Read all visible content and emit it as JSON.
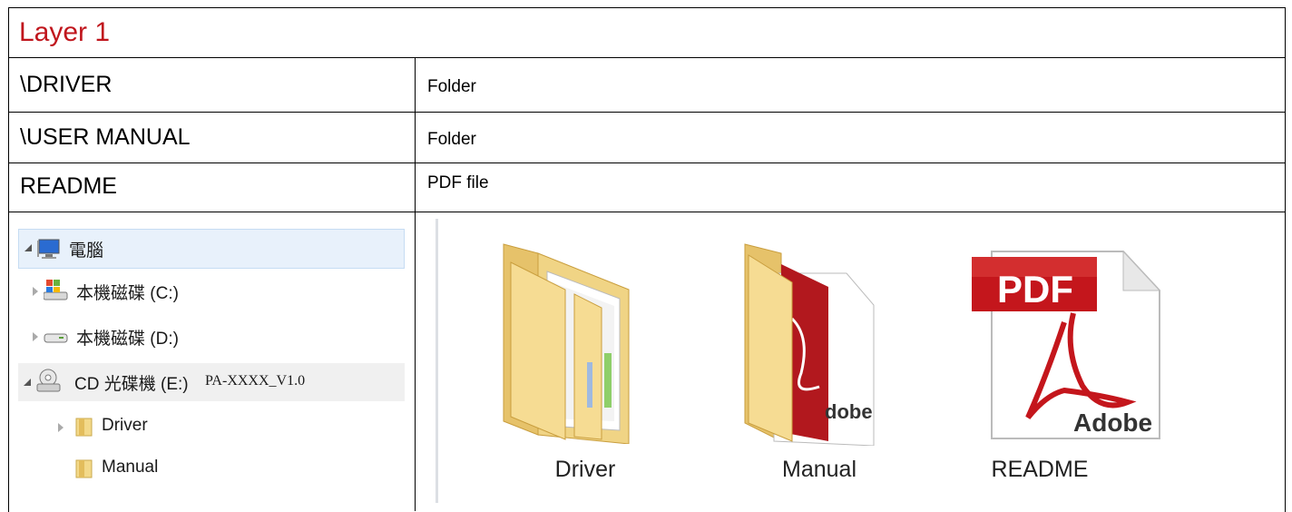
{
  "header": {
    "title": "Layer 1"
  },
  "rows": [
    {
      "name": "\\DRIVER",
      "type": "Folder"
    },
    {
      "name": "\\USER MANUAL",
      "type": "Folder"
    },
    {
      "name": "README",
      "type": "PDF file"
    }
  ],
  "tree": {
    "computer": "電腦",
    "drive_c": "本機磁碟 (C:)",
    "drive_d": "本機磁碟 (D:)",
    "drive_e": "CD 光碟機 (E:)",
    "volume": "PA-XXXX_V1.0",
    "driver": "Driver",
    "manual": "Manual"
  },
  "icons": {
    "driver": "Driver",
    "manual": "Manual",
    "readme": "README",
    "pdf_badge": "PDF",
    "adobe": "Adobe",
    "adobe_partial": "dobe"
  },
  "colors": {
    "title": "#c0161d",
    "folder": "#f3d98a",
    "pdf_red": "#c4161c"
  }
}
